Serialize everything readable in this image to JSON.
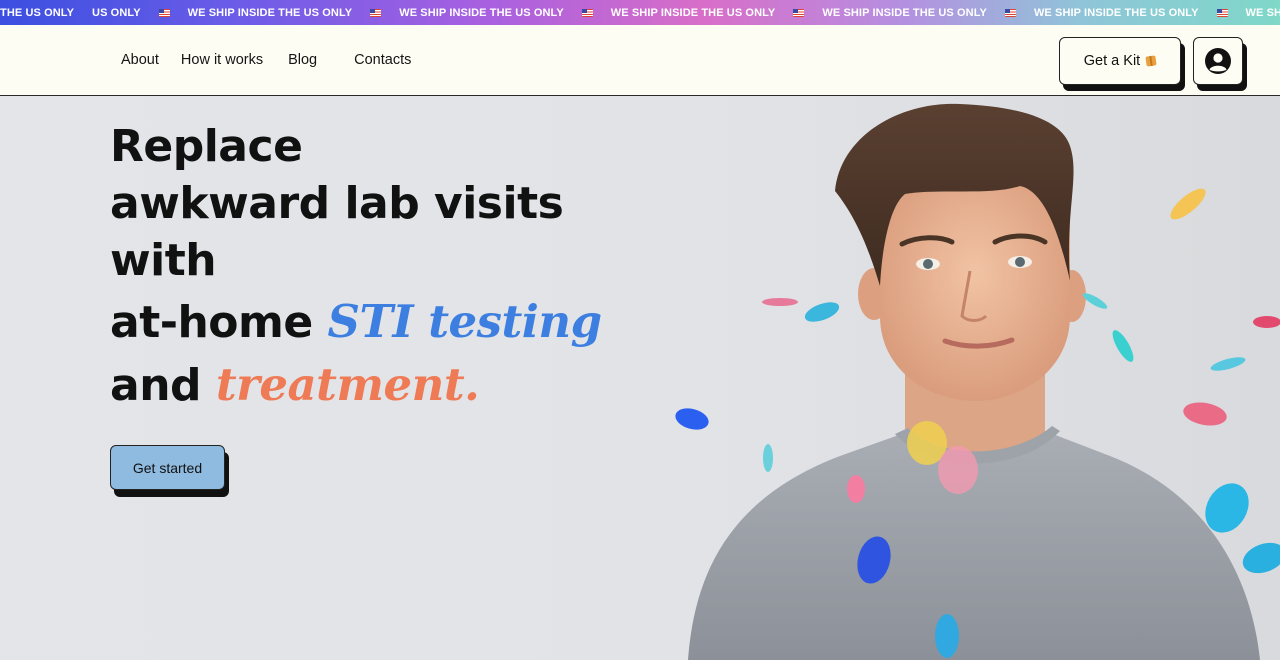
{
  "banner": {
    "items": [
      "THE US ONLY",
      "US ONLY",
      "WE SHIP INSIDE THE US ONLY",
      "WE SHIP INSIDE THE US ONLY",
      "WE SHIP INSIDE THE US ONLY",
      "WE SHIP INSIDE THE US ONLY",
      "WE SHIP INSIDE THE US ONLY",
      "WE SHIP INSIDE THE US ONL"
    ],
    "icon": "us-flag-icon"
  },
  "nav": {
    "about": "About",
    "how_it_works": "How it works",
    "blog": "Blog",
    "contacts": "Contacts"
  },
  "header": {
    "kit_label": "Get a Kit",
    "kit_icon": "package-icon",
    "account_icon": "user-circle-icon"
  },
  "hero": {
    "line1": "Replace",
    "line2": "awkward lab visits",
    "line3": "with",
    "line4_prefix": "at-home ",
    "line4_accent": "STI testing",
    "line5_prefix": "and ",
    "line5_accent": "treatment.",
    "cta_label": "Get started",
    "accent_blue": "#3c7fe0",
    "accent_orange": "#ee7b55",
    "cta_color": "#8fbbe0"
  }
}
